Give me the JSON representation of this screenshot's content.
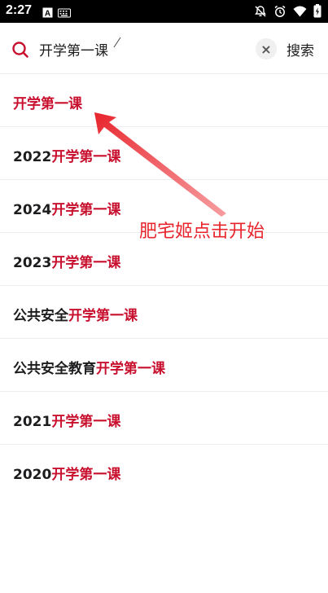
{
  "status_bar": {
    "time": "2:27",
    "left_icons": [
      "a-notification-icon",
      "keyboard-icon"
    ],
    "right_icons": [
      "mute-icon",
      "alarm-icon",
      "wifi-icon",
      "battery-icon"
    ]
  },
  "search": {
    "query": "开学第一课",
    "clear_label": "×",
    "button_label": "搜索",
    "accent_color": "#c8102e"
  },
  "results": [
    {
      "prefix": "",
      "highlight": "开学第一课"
    },
    {
      "prefix": "2022",
      "highlight": "开学第一课"
    },
    {
      "prefix": "2024",
      "highlight": "开学第一课"
    },
    {
      "prefix": "2023",
      "highlight": "开学第一课"
    },
    {
      "prefix": "公共安全",
      "highlight": "开学第一课"
    },
    {
      "prefix": "公共安全教育",
      "highlight": "开学第一课"
    },
    {
      "prefix": "2021",
      "highlight": "开学第一课"
    },
    {
      "prefix": "2020",
      "highlight": "开学第一课"
    }
  ],
  "annotation": {
    "text": "肥宅姬点击开始",
    "color": "#e8242c"
  }
}
